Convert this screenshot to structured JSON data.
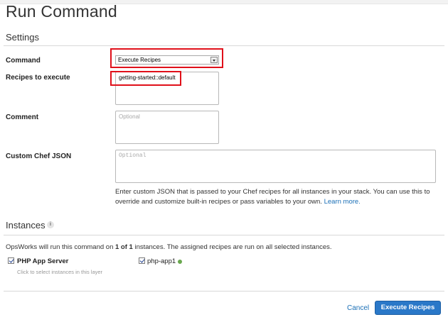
{
  "page": {
    "title": "Run Command"
  },
  "settings": {
    "section_title": "Settings",
    "command": {
      "label": "Command",
      "value": "Execute Recipes"
    },
    "recipes": {
      "label": "Recipes to execute",
      "value": "getting-started::default"
    },
    "comment": {
      "label": "Comment",
      "placeholder": "Optional"
    },
    "custom_json": {
      "label": "Custom Chef JSON",
      "placeholder": "Optional",
      "help_text": "Enter custom JSON that is passed to your Chef recipes for all instances in your stack. You can use this to override and customize built-in recipes or pass variables to your own.",
      "help_link": "Learn more."
    }
  },
  "instances": {
    "section_title": "Instances",
    "info_icon": "i",
    "summary_prefix": "OpsWorks will run this command on",
    "summary_count": "1 of 1",
    "summary_suffix": "instances. The assigned recipes are run on all selected instances.",
    "layer": {
      "name": "PHP App Server",
      "hint": "Click to select instances in this layer",
      "checked": true
    },
    "instance": {
      "name": "php-app1",
      "checked": true,
      "status_color": "#6aa84f"
    }
  },
  "footer": {
    "cancel_label": "Cancel",
    "submit_label": "Execute Recipes"
  },
  "colors": {
    "highlight": "#e0101a",
    "primary": "#2a78c8",
    "link": "#1a6fb6"
  }
}
